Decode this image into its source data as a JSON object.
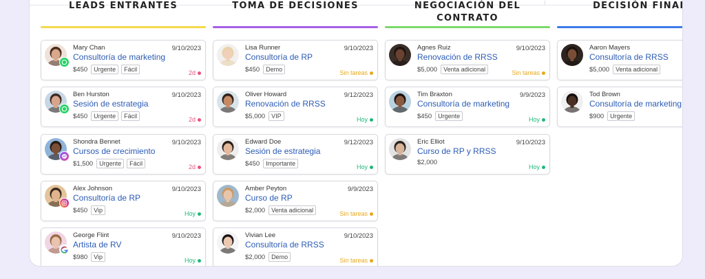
{
  "colors": {
    "yellow": "#f5d94a",
    "purple": "#a65ee6",
    "green": "#7bd96a",
    "blue": "#3b7ae8",
    "red": "#e8527a",
    "teal": "#1fb97a",
    "amber": "#e7a81b"
  },
  "columns": [
    {
      "title": "LEADS ENTRANTES",
      "bar": "#f5d94a",
      "cards": [
        {
          "name": "Mary Chan",
          "date": "9/10/2023",
          "title": "Consultoría de marketing",
          "price": "$450",
          "tags": [
            "Urgente",
            "Fácil"
          ],
          "status": "2d",
          "statusColor": "#e8527a",
          "source": "whatsapp-icon",
          "skin": "#d9a88a",
          "hair": "#4a2a1f",
          "bg": "#efe2da"
        },
        {
          "name": "Ben Hurston",
          "date": "9/10/2023",
          "title": "Sesión de estrategia",
          "price": "$450",
          "tags": [
            "Urgente",
            "Fácil"
          ],
          "status": "2d",
          "statusColor": "#e8527a",
          "source": "whatsapp-icon",
          "skin": "#d9a58a",
          "hair": "#3a2a22",
          "bg": "#c9d7e4"
        },
        {
          "name": "Shondra Bennet",
          "date": "9/10/2023",
          "title": "Cursos de crecimiento",
          "price": "$1,500",
          "tags": [
            "Urgente",
            "Fácil"
          ],
          "status": "2d",
          "statusColor": "#e8527a",
          "source": "messenger-icon",
          "skin": "#7a4f38",
          "hair": "#2a1a14",
          "bg": "#8fb4d9"
        },
        {
          "name": "Alex Johnson",
          "date": "9/10/2023",
          "title": "Consultoría de RP",
          "price": "$450",
          "tags": [
            "Vip"
          ],
          "status": "Hoy",
          "statusColor": "#1fb97a",
          "source": "instagram-icon",
          "skin": "#e0b48f",
          "hair": "#3b2a1d",
          "bg": "#e3c49b"
        },
        {
          "name": "George Flint",
          "date": "9/10/2023",
          "title": "Artista de RV",
          "price": "$980",
          "tags": [
            "Vip"
          ],
          "status": "Hoy",
          "statusColor": "#1fb97a",
          "source": "google-icon",
          "skin": "#e9c3ae",
          "hair": "#9a6a4a",
          "bg": "#f0d6e4"
        }
      ]
    },
    {
      "title": "TOMA DE DECISIONES",
      "bar": "#a65ee6",
      "cards": [
        {
          "name": "Lisa Runner",
          "date": "9/10/2023",
          "title": "Consultoría de RP",
          "price": "$450",
          "tags": [
            "Demo"
          ],
          "status": "Sin tareas",
          "statusColor": "#e7a81b",
          "source": "",
          "skin": "#f0d0b8",
          "hair": "#e8d2a8",
          "bg": "#f2f0ee"
        },
        {
          "name": "Oliver Howard",
          "date": "9/12/2023",
          "title": "Renovación de RRSS",
          "price": "$5,000",
          "tags": [
            "VIP"
          ],
          "status": "Hoy",
          "statusColor": "#1fb97a",
          "source": "",
          "skin": "#c48a66",
          "hair": "#2e2018",
          "bg": "#d8e4ea"
        },
        {
          "name": "Edward Doe",
          "date": "9/12/2023",
          "title": "Sesión de estrategia",
          "price": "$450",
          "tags": [
            "Importante"
          ],
          "status": "Hoy",
          "statusColor": "#1fb97a",
          "source": "",
          "skin": "#e4b89a",
          "hair": "#2a201a",
          "bg": "#eeeeee"
        },
        {
          "name": "Amber Peyton",
          "date": "9/9/2023",
          "title": "Curso de RP",
          "price": "$2,000",
          "tags": [
            "Venta adicional"
          ],
          "status": "Sin tareas",
          "statusColor": "#e7a81b",
          "source": "",
          "skin": "#e8c4a8",
          "hair": "#c89a6a",
          "bg": "#9fb8cc"
        },
        {
          "name": "Vivian Lee",
          "date": "9/10/2023",
          "title": "Consultoría de RRSS",
          "price": "$2,000",
          "tags": [
            "Demo"
          ],
          "status": "Sin tareas",
          "statusColor": "#e7a81b",
          "source": "",
          "skin": "#ecc8b0",
          "hair": "#1a1414",
          "bg": "#f4f4f4"
        }
      ]
    },
    {
      "title": "NEGOCIACIÓN DEL CONTRATO",
      "bar": "#7bd96a",
      "cards": [
        {
          "name": "Agnes Ruiz",
          "date": "9/10/2023",
          "title": "Renovación de RRSS",
          "price": "$5,000",
          "tags": [
            "Venta adicional"
          ],
          "status": "Sin tareas",
          "statusColor": "#e7a81b",
          "source": "",
          "skin": "#6a4232",
          "hair": "#1e1410",
          "bg": "#3a2e28"
        },
        {
          "name": "Tim Braxton",
          "date": "9/9/2023",
          "title": "Consultoría de marketing",
          "price": "$450",
          "tags": [
            "Urgente"
          ],
          "status": "Hoy",
          "statusColor": "#1fb97a",
          "source": "",
          "skin": "#8a5a40",
          "hair": "#1a1210",
          "bg": "#b9d2df"
        },
        {
          "name": "Eric Elliot",
          "date": "9/10/2023",
          "title": "Curso de RP y RRSS",
          "price": "$2,000",
          "tags": [],
          "status": "Hoy",
          "statusColor": "#1fb97a",
          "source": "",
          "skin": "#d8b49a",
          "hair": "#2a2420",
          "bg": "#e2e2e2"
        }
      ]
    },
    {
      "title": "DECISIÓN FINAL",
      "bar": "#3b7ae8",
      "cards": [
        {
          "name": "Aaron Mayers",
          "date": "",
          "title": "Consultoría de RRSS",
          "price": "$5,000",
          "tags": [
            "Venta adicional"
          ],
          "status": "",
          "statusColor": "#1fb97a",
          "source": "",
          "skin": "#7a4e36",
          "hair": "#1a120e",
          "bg": "#2e2420"
        },
        {
          "name": "Tod Brown",
          "date": "",
          "title": "Consultoría de marketing",
          "price": "$900",
          "tags": [
            "Urgente"
          ],
          "status": "",
          "statusColor": "#1fb97a",
          "source": "",
          "skin": "#4a3024",
          "hair": "#140e0c",
          "bg": "#f0f0f0"
        }
      ]
    }
  ]
}
